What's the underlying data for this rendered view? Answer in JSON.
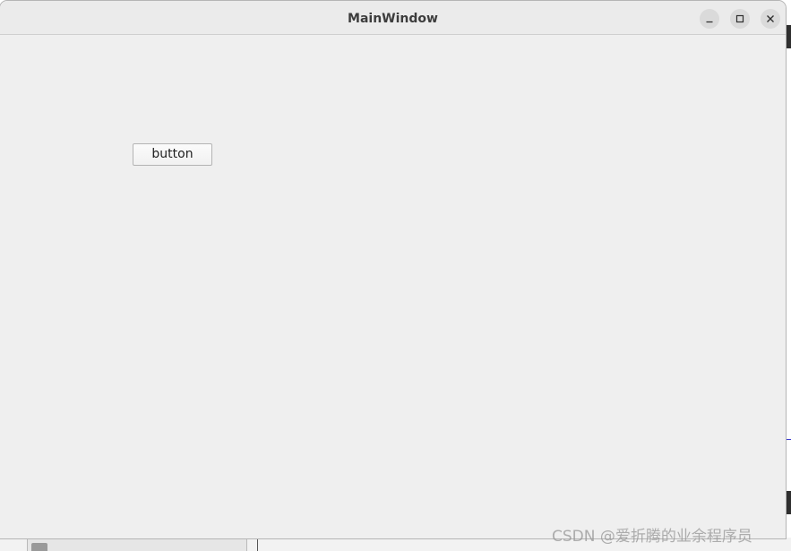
{
  "window": {
    "title": "MainWindow",
    "controls": {
      "minimize": "minimize-icon",
      "maximize": "maximize-icon",
      "close": "close-icon"
    }
  },
  "content": {
    "button_label": "button"
  },
  "watermark": "CSDN @爱折腾的业余程序员",
  "colors": {
    "window_bg": "#efefef",
    "titlebar_bg": "#ebebeb",
    "title_text": "#3d3d3d",
    "control_bg": "#dadada"
  }
}
